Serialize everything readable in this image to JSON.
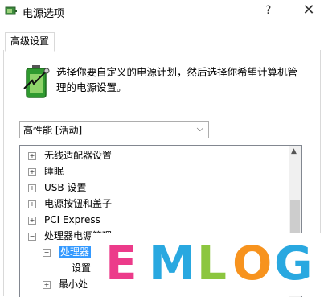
{
  "window": {
    "title": "电源选项",
    "help": "?",
    "close": "✕"
  },
  "tab": {
    "label": "高级设置"
  },
  "description": "选择你要自定义的电源计划，然后选择你希望计算机管理的电源设置。",
  "plan_select": {
    "value": "高性能 [活动]"
  },
  "tree": {
    "items": [
      {
        "label": "无线适配器设置",
        "expander": "+"
      },
      {
        "label": "睡眠",
        "expander": "+"
      },
      {
        "label": "USB 设置",
        "expander": "+"
      },
      {
        "label": "电源按钮和盖子",
        "expander": "+"
      },
      {
        "label": "PCI Express",
        "expander": "+"
      },
      {
        "label": "处理器电源管理",
        "expander": "−"
      },
      {
        "label": "处理器",
        "expander": "−"
      },
      {
        "label": "设置"
      },
      {
        "label": "最小处",
        "expander": "+"
      }
    ]
  },
  "brand": {
    "letters": [
      {
        "char": "E",
        "color": "#ec3b8a"
      },
      {
        "char": "M",
        "color": "#29a8e0"
      },
      {
        "char": "L",
        "color": "#8cc63f"
      },
      {
        "char": "O",
        "color": "#f7931e"
      },
      {
        "char": "G",
        "color": "#29a8e0"
      }
    ]
  }
}
